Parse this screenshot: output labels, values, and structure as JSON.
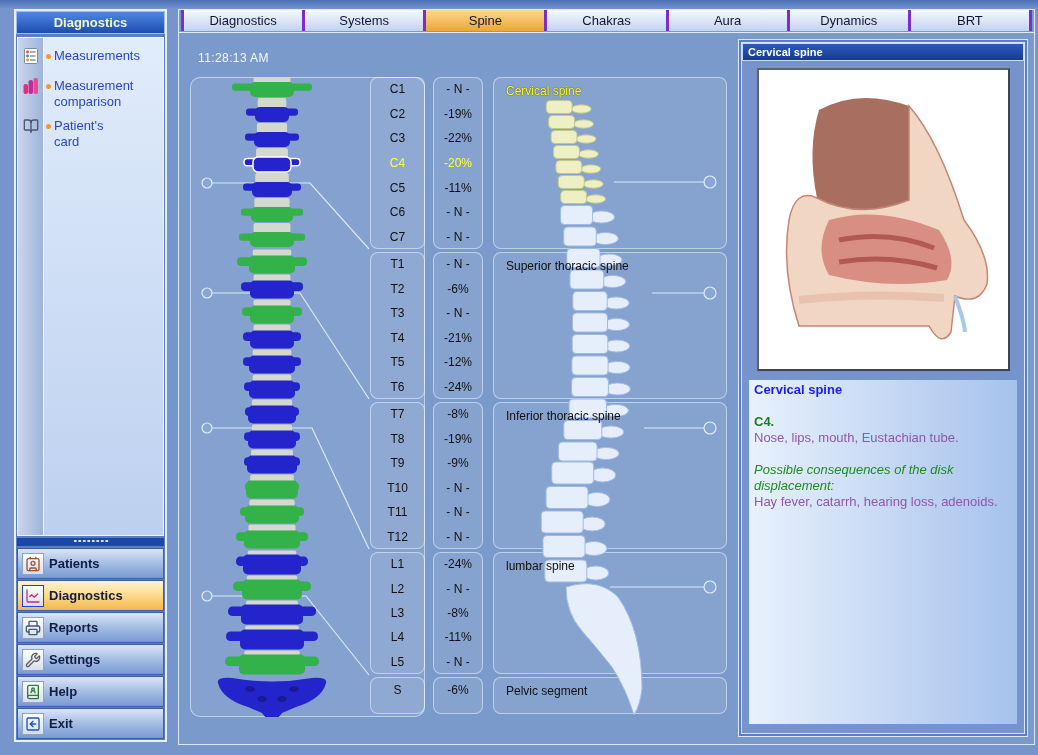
{
  "sidebar": {
    "title": "Diagnostics",
    "items": [
      {
        "label": "Measurements"
      },
      {
        "label": "Measurement comparison"
      },
      {
        "label": "Patient's card"
      }
    ],
    "nav": [
      {
        "label": "Patients",
        "selected": false
      },
      {
        "label": "Diagnostics",
        "selected": true
      },
      {
        "label": "Reports",
        "selected": false
      },
      {
        "label": "Settings",
        "selected": false
      },
      {
        "label": "Help",
        "selected": false
      },
      {
        "label": "Exit",
        "selected": false
      }
    ]
  },
  "tabs": [
    {
      "label": "Diagnostics",
      "selected": false
    },
    {
      "label": "Systems",
      "selected": false
    },
    {
      "label": "Spine",
      "selected": true
    },
    {
      "label": "Chakras",
      "selected": false
    },
    {
      "label": "Aura",
      "selected": false
    },
    {
      "label": "Dynamics",
      "selected": false
    },
    {
      "label": "BRT",
      "selected": false
    }
  ],
  "time": "11:28:13 AM",
  "sections": [
    {
      "label": "Cervical spine",
      "kind": "column",
      "selected": true,
      "vertebrae": [
        {
          "name": "C1",
          "value": "- N -",
          "selected": false,
          "color": "#33b24a"
        },
        {
          "name": "C2",
          "value": "-19%",
          "selected": false,
          "color": "#2424cc"
        },
        {
          "name": "C3",
          "value": "-22%",
          "selected": false,
          "color": "#2424cc"
        },
        {
          "name": "C4",
          "value": "-20%",
          "selected": true,
          "color": "#2424cc"
        },
        {
          "name": "C5",
          "value": "-11%",
          "selected": false,
          "color": "#2424cc"
        },
        {
          "name": "C6",
          "value": "- N -",
          "selected": false,
          "color": "#33b24a"
        },
        {
          "name": "C7",
          "value": "- N -",
          "selected": false,
          "color": "#33b24a"
        }
      ]
    },
    {
      "label": "Superior thoracic spine",
      "kind": "column",
      "selected": false,
      "vertebrae": [
        {
          "name": "T1",
          "value": "- N -",
          "selected": false,
          "color": "#33b24a"
        },
        {
          "name": "T2",
          "value": "-6%",
          "selected": false,
          "color": "#2424cc"
        },
        {
          "name": "T3",
          "value": "- N -",
          "selected": false,
          "color": "#33b24a"
        },
        {
          "name": "T4",
          "value": "-21%",
          "selected": false,
          "color": "#2424cc"
        },
        {
          "name": "T5",
          "value": "-12%",
          "selected": false,
          "color": "#2424cc"
        },
        {
          "name": "T6",
          "value": "-24%",
          "selected": false,
          "color": "#2424cc"
        }
      ]
    },
    {
      "label": "Inferior thoracic spine",
      "kind": "column",
      "selected": false,
      "vertebrae": [
        {
          "name": "T7",
          "value": "-8%",
          "selected": false,
          "color": "#2424cc"
        },
        {
          "name": "T8",
          "value": "-19%",
          "selected": false,
          "color": "#2424cc"
        },
        {
          "name": "T9",
          "value": "-9%",
          "selected": false,
          "color": "#2424cc"
        },
        {
          "name": "T10",
          "value": "- N -",
          "selected": false,
          "color": "#33b24a"
        },
        {
          "name": "T11",
          "value": "- N -",
          "selected": false,
          "color": "#33b24a"
        },
        {
          "name": "T12",
          "value": "- N -",
          "selected": false,
          "color": "#33b24a"
        }
      ]
    },
    {
      "label": "lumbar spine",
      "kind": "column",
      "selected": false,
      "vertebrae": [
        {
          "name": "L1",
          "value": "-24%",
          "selected": false,
          "color": "#2424cc"
        },
        {
          "name": "L2",
          "value": "- N -",
          "selected": false,
          "color": "#33b24a"
        },
        {
          "name": "L3",
          "value": "-8%",
          "selected": false,
          "color": "#2424cc"
        },
        {
          "name": "L4",
          "value": "-11%",
          "selected": false,
          "color": "#2424cc"
        },
        {
          "name": "L5",
          "value": "- N -",
          "selected": false,
          "color": "#33b24a"
        }
      ]
    },
    {
      "label": "Pelvic segment",
      "kind": "sacrum",
      "selected": false,
      "vertebrae": [
        {
          "name": "S",
          "value": "-6%",
          "selected": false,
          "color": "#2424cc"
        }
      ]
    }
  ],
  "info_panel": {
    "title": "Cervical spine",
    "heading": "Cervical spine",
    "vertebra": "C4.",
    "organs": "Nose, lips, mouth, Eustachian tube.",
    "consequences_label": "Possible consequences of the disk displacement:",
    "consequences": "Hay fever, catarrh, hearing loss, adenoids."
  }
}
